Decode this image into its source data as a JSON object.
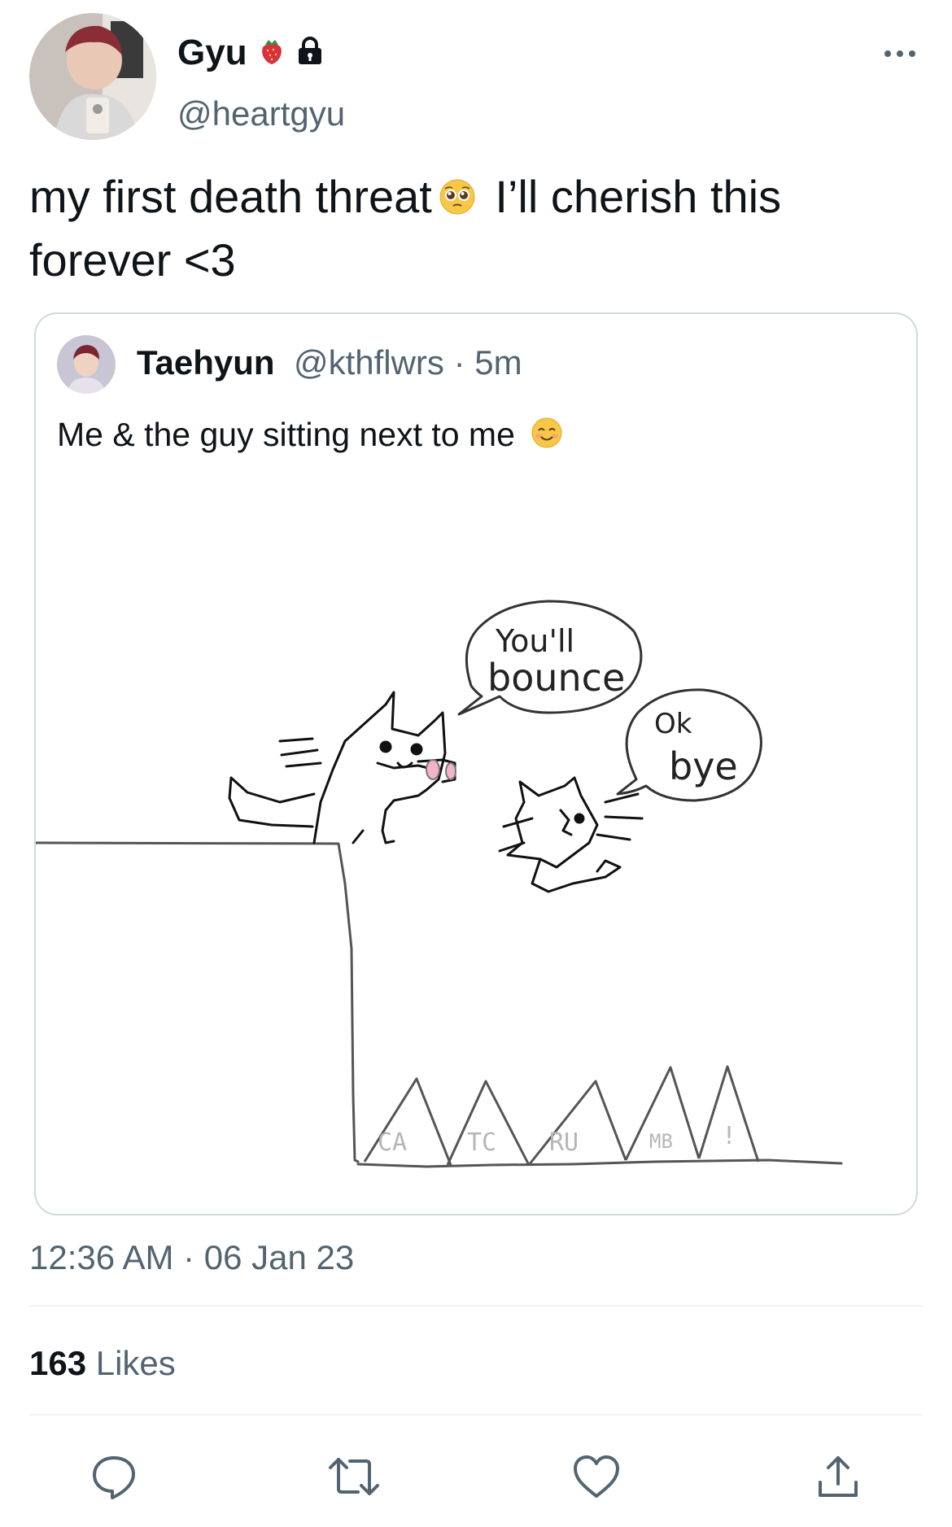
{
  "author": {
    "display_name": "Gyu",
    "handle": "@heartgyu",
    "name_emoji_icon": "strawberry-icon",
    "protected_icon": "lock-icon"
  },
  "tweet": {
    "text_part1": "my first death threat",
    "text_emoji_icon": "pleading-face-icon",
    "text_part2": " I’ll cherish this forever <3"
  },
  "quoted_tweet": {
    "display_name": "Taehyun",
    "handle": "@kthflwrs",
    "separator": "·",
    "time": "5m",
    "text": "Me & the guy sitting next to me",
    "text_emoji_icon": "smiling-face-icon",
    "drawing": {
      "bubble1_line1": "You'll",
      "bubble1_line2": "bounce",
      "bubble2_line1": "Ok",
      "bubble2_line2": "bye",
      "spike_labels": [
        "CA",
        "TC",
        "RU",
        "MB",
        "!"
      ]
    }
  },
  "timestamp": "12:36 AM · 06 Jan 23",
  "likes": {
    "count": "163",
    "label": " Likes"
  },
  "actions": [
    "reply-icon",
    "retweet-icon",
    "like-icon",
    "share-icon"
  ],
  "colors": {
    "text": "#0f1419",
    "secondary": "#536471",
    "border": "#cfd9de",
    "divider": "#eff3f4"
  }
}
